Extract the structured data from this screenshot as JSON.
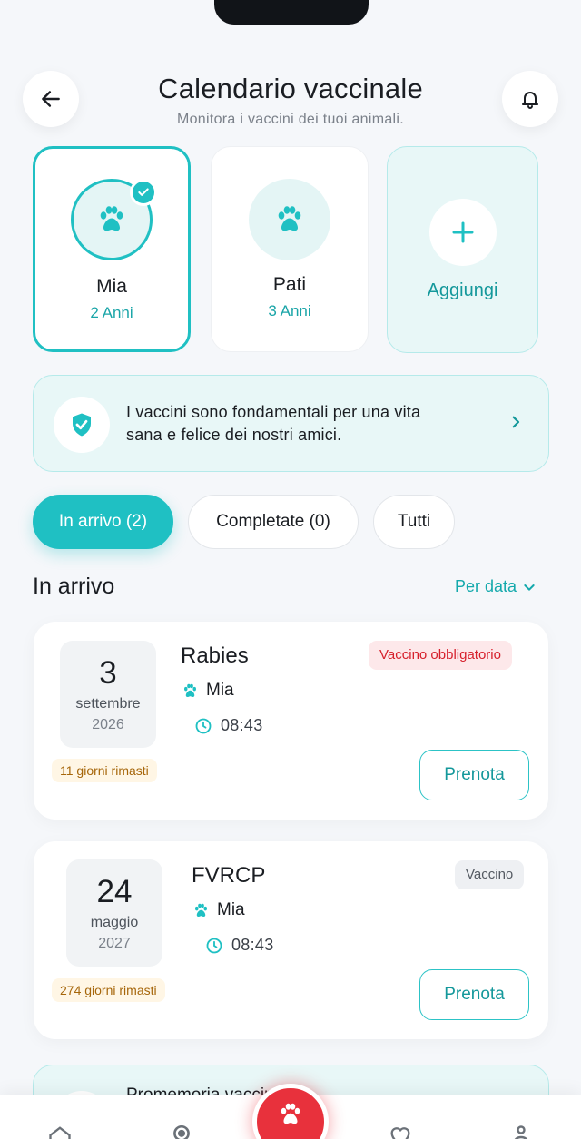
{
  "header": {
    "title": "Calendario vaccinale",
    "subtitle": "Monitora i vaccini dei tuoi animali."
  },
  "pets": [
    {
      "name": "Mia",
      "age": "2 Anni",
      "selected": true
    },
    {
      "name": "Pati",
      "age": "3 Anni",
      "selected": false
    }
  ],
  "add_pet": {
    "label": "Aggiungi"
  },
  "info_banner": {
    "line1": "I vaccini sono fondamentali per una vita",
    "line2": "sana e felice dei nostri amici."
  },
  "tabs": [
    {
      "label": "In arrivo (2)",
      "active": true
    },
    {
      "label": "Completate (0)",
      "active": false
    },
    {
      "label": "Tutti",
      "active": false
    }
  ],
  "section": {
    "title": "In arrivo",
    "sort_label": "Per data"
  },
  "vaccines": [
    {
      "day": "3",
      "month": "settembre",
      "year": "2026",
      "days_left": "11 giorni rimasti",
      "name": "Rabies",
      "pet": "Mia",
      "time": "08:43",
      "badge": "Vaccino obbligatorio",
      "badge_type": "required",
      "action": "Prenota"
    },
    {
      "day": "24",
      "month": "maggio",
      "year": "2027",
      "days_left": "274 giorni rimasti",
      "name": "FVRCP",
      "pet": "Mia",
      "time": "08:43",
      "badge": "Vaccino",
      "badge_type": "normal",
      "action": "Prenota"
    }
  ],
  "reminder": {
    "title": "Promemoria vaccini"
  },
  "nav": {
    "items": [
      "home-icon",
      "location-icon",
      "paw-icon",
      "heart-icon",
      "profile-icon"
    ]
  },
  "colors": {
    "accent": "#1fc0c3",
    "danger": "#e8313c",
    "warning_text": "#a6660a",
    "background": "#f5f7fa"
  }
}
